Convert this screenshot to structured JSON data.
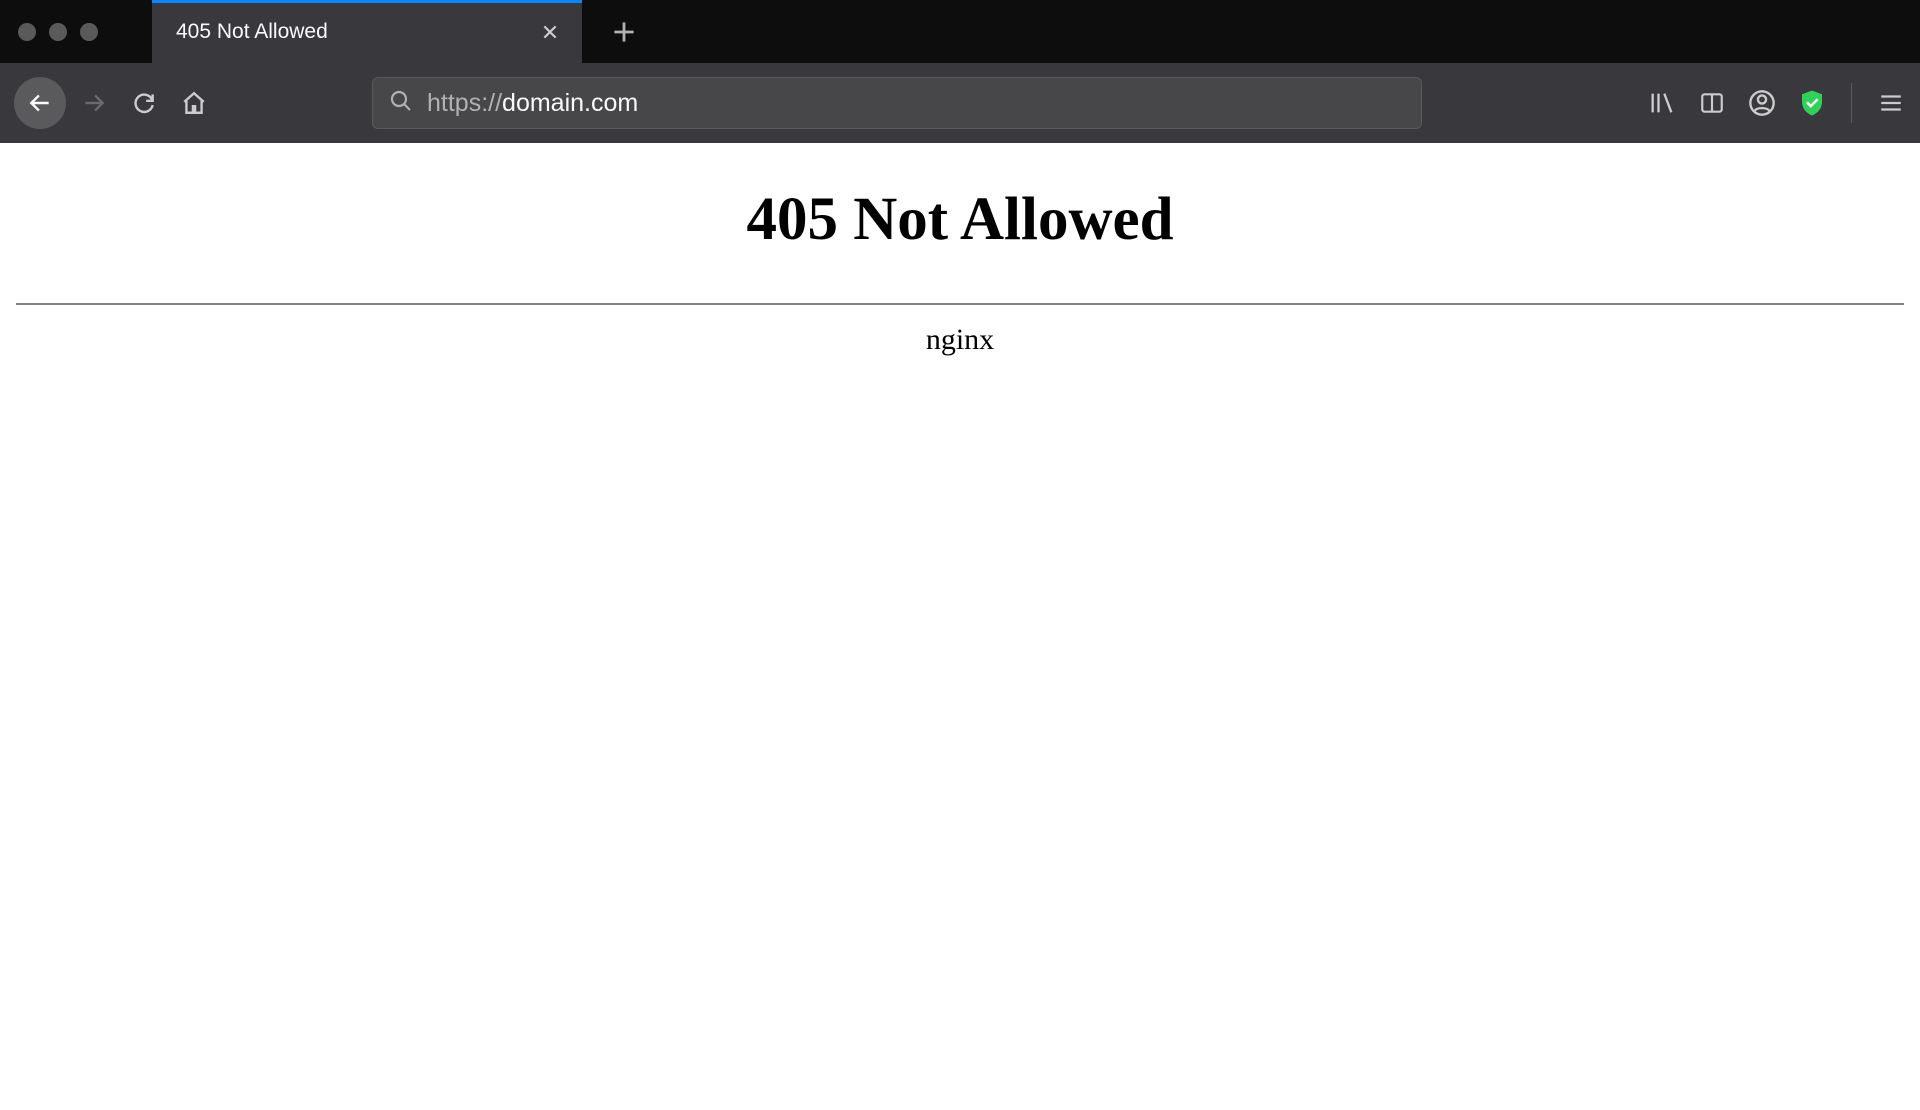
{
  "browser": {
    "tab": {
      "title": "405 Not Allowed"
    },
    "url": {
      "protocol": "https://",
      "domain": "domain.com"
    }
  },
  "page": {
    "heading": "405 Not Allowed",
    "server": "nginx"
  }
}
